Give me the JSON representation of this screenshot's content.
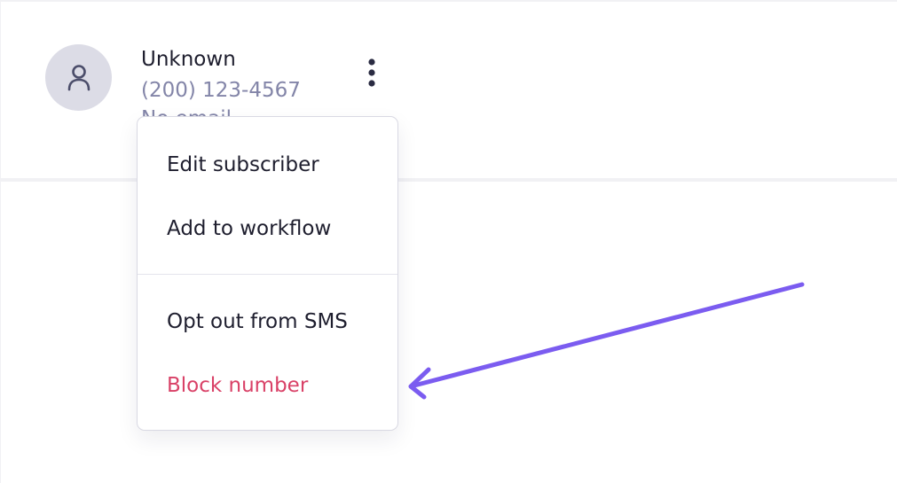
{
  "contact": {
    "name": "Unknown",
    "phone": "(200) 123-4567",
    "email_status": "No email"
  },
  "icons": {
    "avatar": "user-icon",
    "more": "vertical-ellipsis-icon",
    "annotation": "arrow-icon"
  },
  "menu": {
    "items": [
      {
        "label": "Edit subscriber"
      },
      {
        "label": "Add to workflow"
      },
      {
        "label": "Opt out from SMS"
      },
      {
        "label": "Block number"
      }
    ]
  },
  "colors": {
    "text": "#1e1e2e",
    "muted": "#8385a8",
    "danger": "#d94167",
    "annotation": "#7b5cf0"
  }
}
